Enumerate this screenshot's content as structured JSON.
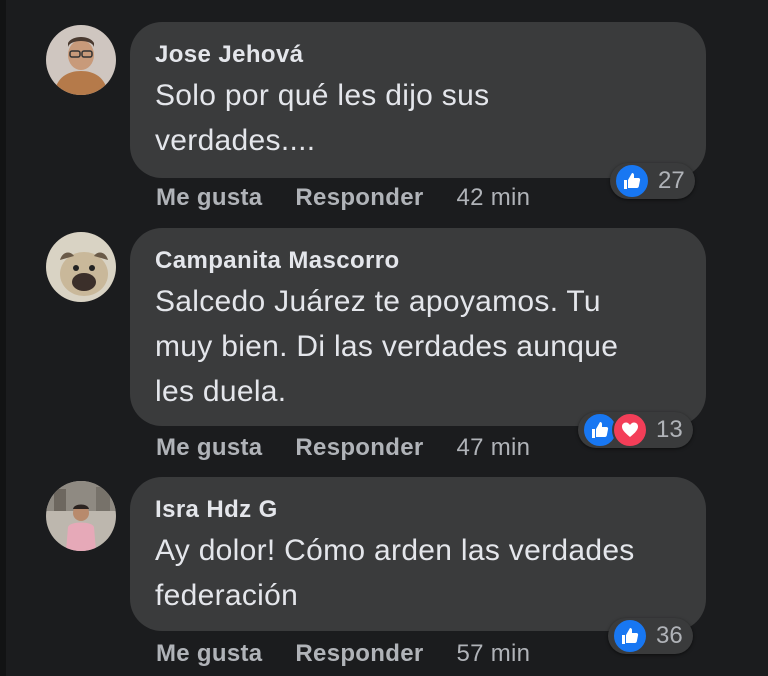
{
  "comments": [
    {
      "author": "Jose Jehová",
      "lines": [
        "Solo por qué les dijo sus",
        "verdades...."
      ],
      "like_label": "Me gusta",
      "reply_label": "Responder",
      "time": "42 min",
      "reactions": [
        "like-icon"
      ],
      "reaction_count": "27"
    },
    {
      "author": "Campanita Mascorro",
      "lines": [
        "Salcedo Juárez te apoyamos. Tu",
        "muy bien. Di las verdades aunque",
        "les duela."
      ],
      "like_label": "Me gusta",
      "reply_label": "Responder",
      "time": "47 min",
      "reactions": [
        "like-icon",
        "love-icon"
      ],
      "reaction_count": "13"
    },
    {
      "author": "Isra Hdz G",
      "lines": [
        "Ay dolor! Cómo arden las verdades",
        "federación"
      ],
      "like_label": "Me gusta",
      "reply_label": "Responder",
      "time": "57 min",
      "reactions": [
        "like-icon"
      ],
      "reaction_count": "36"
    }
  ],
  "colors": {
    "background": "#1b1c1e",
    "bubble": "#3a3b3c",
    "text": "#e4e6eb",
    "secondary_text": "#b0b3b8",
    "like_blue": "#1877f2",
    "love_red": "#f33e58"
  }
}
